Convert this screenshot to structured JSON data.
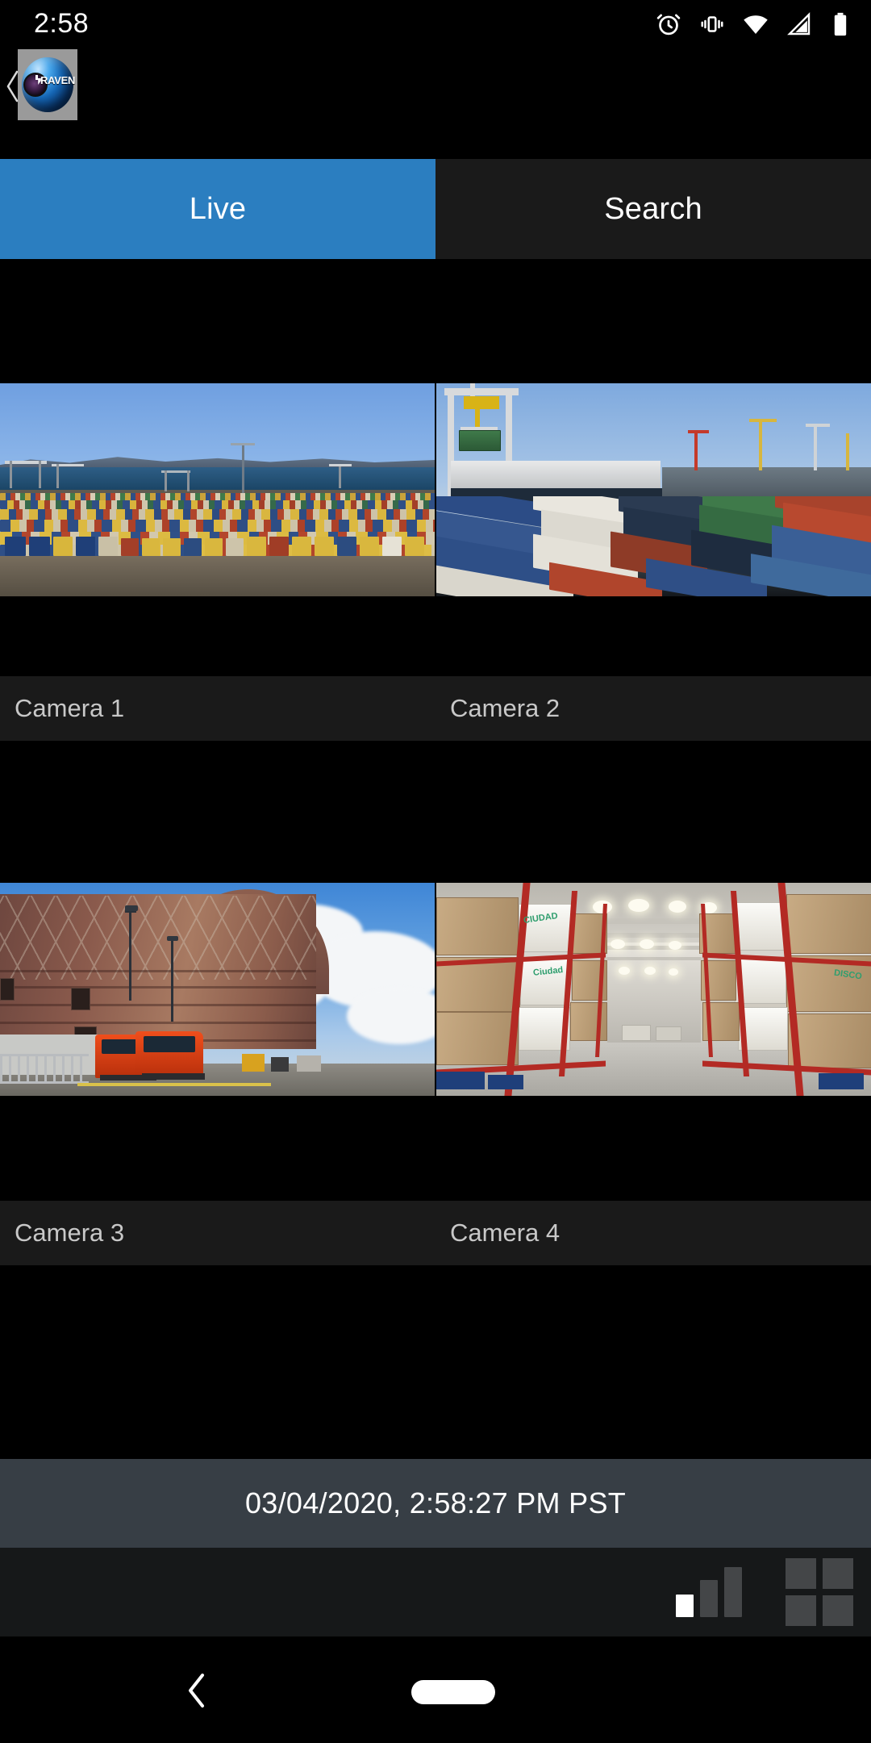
{
  "status_bar": {
    "time": "2:58",
    "icons": [
      "alarm-icon",
      "vibrate-icon",
      "wifi-icon",
      "cellular-signal-icon",
      "battery-icon"
    ]
  },
  "app": {
    "logo_text": "RAVEN IP",
    "back_chevron": "back-chevron-icon"
  },
  "tabs": [
    {
      "label": "Live",
      "active": true
    },
    {
      "label": "Search",
      "active": false
    }
  ],
  "colors": {
    "accent_blue": "#2b7ec0",
    "tab_inactive": "#1a1a1a",
    "label_bar": "#1a1a1a",
    "label_text": "#c8c8c8",
    "timestamp_bar": "#373e45",
    "toolbar_bg": "#161819",
    "icon_gray": "#444648",
    "icon_active": "#ffffff",
    "background": "#000000"
  },
  "grid": {
    "layout": "2x2",
    "cameras": [
      {
        "label": "Camera 1",
        "scene": "shipping container port with stacked containers and sea"
      },
      {
        "label": "Camera 2",
        "scene": "port gantry crane loading ship with container yard"
      },
      {
        "label": "Camera 3",
        "scene": "brick warehouse exterior with red semi trucks at loading dock"
      },
      {
        "label": "Camera 4",
        "scene": "warehouse interior aisle with pallet racking"
      }
    ]
  },
  "timestamp": {
    "text": "03/04/2020, 2:58:27 PM PST"
  },
  "toolbar": {
    "quality_icon": "signal-quality-bars-icon",
    "quality_level": 1,
    "quality_total": 3,
    "layout_icon": "grid-layout-2x2-icon"
  },
  "navigation": {
    "back": "back-icon",
    "home": "home-pill-icon"
  }
}
